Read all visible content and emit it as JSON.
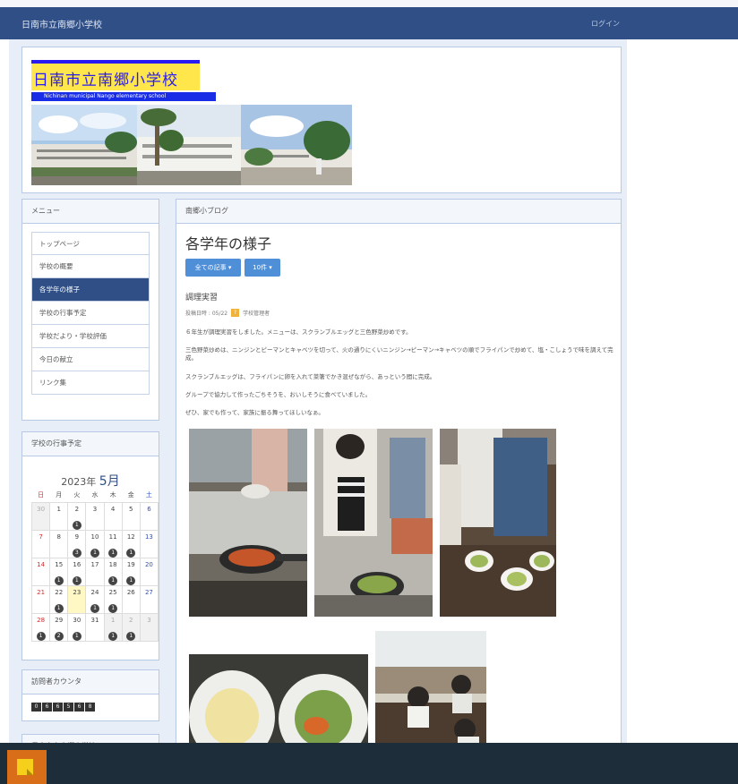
{
  "topbar": {
    "site_name": "日南市立南郷小学校",
    "login": "ログイン"
  },
  "header": {
    "logo_title": "日南市立南郷小学校",
    "logo_subtitle": "Nichinan municipal Nango elementary school"
  },
  "menu": {
    "title": "メニュー",
    "items": [
      {
        "label": "トップページ"
      },
      {
        "label": "学校の概要"
      },
      {
        "label": "各学年の様子"
      },
      {
        "label": "学校の行事予定"
      },
      {
        "label": "学校だより・学校評価"
      },
      {
        "label": "今日の献立"
      },
      {
        "label": "リンク集"
      }
    ],
    "active_index": 2
  },
  "calendar": {
    "panel_title": "学校の行事予定",
    "year": "2023年",
    "month": "5月",
    "weekdays": [
      "日",
      "月",
      "火",
      "水",
      "木",
      "金",
      "土"
    ],
    "weeks": [
      [
        {
          "d": "30",
          "muted": true
        },
        {
          "d": "1"
        },
        {
          "d": "2",
          "n": "1"
        },
        {
          "d": "3"
        },
        {
          "d": "4"
        },
        {
          "d": "5"
        },
        {
          "d": "6"
        }
      ],
      [
        {
          "d": "7"
        },
        {
          "d": "8"
        },
        {
          "d": "9",
          "n": "3"
        },
        {
          "d": "10",
          "n": "1"
        },
        {
          "d": "11",
          "n": "1"
        },
        {
          "d": "12",
          "n": "1"
        },
        {
          "d": "13"
        }
      ],
      [
        {
          "d": "14"
        },
        {
          "d": "15",
          "n": "1"
        },
        {
          "d": "16",
          "n": "1"
        },
        {
          "d": "17"
        },
        {
          "d": "18",
          "n": "1"
        },
        {
          "d": "19",
          "n": "1"
        },
        {
          "d": "20"
        }
      ],
      [
        {
          "d": "21"
        },
        {
          "d": "22",
          "n": "1"
        },
        {
          "d": "23",
          "today": true
        },
        {
          "d": "24",
          "n": "1"
        },
        {
          "d": "25",
          "n": "1"
        },
        {
          "d": "26"
        },
        {
          "d": "27"
        }
      ],
      [
        {
          "d": "28",
          "n": "1"
        },
        {
          "d": "29",
          "n": "2"
        },
        {
          "d": "30",
          "n": "1"
        },
        {
          "d": "31"
        },
        {
          "d": "1",
          "muted": true,
          "n": "1"
        },
        {
          "d": "2",
          "muted": true,
          "n": "1"
        },
        {
          "d": "3",
          "muted": true
        }
      ]
    ]
  },
  "counter": {
    "title": "訪問者カウンタ",
    "digits": [
      "0",
      "6",
      "6",
      "5",
      "6",
      "8"
    ]
  },
  "extra_panel": {
    "title": "日南市立南郷小学校"
  },
  "blog": {
    "panel_title": "南郷小ブログ",
    "title": "各学年の様子",
    "filter_all": "全ての記事 ▾",
    "filter_count": "10件 ▾",
    "post_title": "調理実習",
    "post_meta": "投稿日時 : 05/22",
    "post_author": "学校管理者",
    "paragraphs": [
      "６年生が調理実習をしました。メニューは、スクランブルエッグと三色野菜炒めです。",
      "三色野菜炒めは、ニンジンとピーマンとキャベツを切って、火の通りにくいニンジン→ピーマン→キャベツの順でフライパンで炒めて、塩・こしょうで味を調えて完成。",
      "スクランブルエッグは、フライパンに卵を入れて菜箸でかき混ぜながら、あっという間に完成。",
      "グループで協力して作ったごちそうを、おいしそうに食べていました。",
      "ぜひ、家でも作って、家族に振る舞ってほしいなぁ。"
    ]
  },
  "colors": {
    "primary": "#2f4f86",
    "accent_button": "#4f8fd8",
    "taskbar": "#1d2d3a"
  },
  "taskbar": {
    "icon": "sticky-notes-icon"
  }
}
